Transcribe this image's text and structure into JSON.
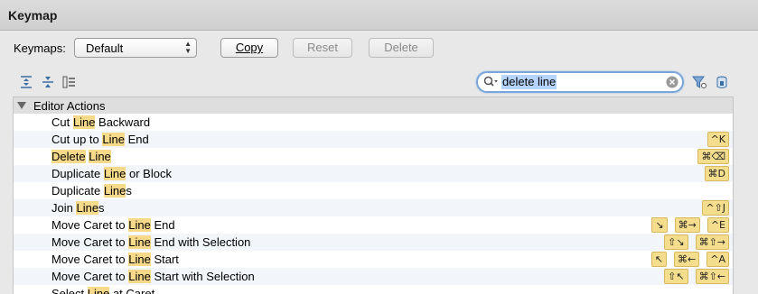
{
  "window": {
    "title": "Keymap"
  },
  "keymaps": {
    "label": "Keymaps:",
    "selected": "Default",
    "copy_label": "Copy",
    "reset_label": "Reset",
    "delete_label": "Delete"
  },
  "toolbar": {
    "icons": [
      "expand-all-icon",
      "collapse-all-icon",
      "edit-shortcut-icon",
      "filter-by-shortcut-icon",
      "clear-filter-icon"
    ]
  },
  "search": {
    "value": "delete line"
  },
  "tree": {
    "group_label": "Editor Actions",
    "actions": [
      {
        "pre": "Cut ",
        "hl": "Line",
        "post": " Backward",
        "keys": []
      },
      {
        "pre": "Cut up to ",
        "hl": "Line",
        "post": " End",
        "keys": [
          "^K"
        ]
      },
      {
        "pre": "",
        "hl": "Delete",
        "mid": " ",
        "hl2": "Line",
        "post": "",
        "keys": [
          "⌘⌫"
        ]
      },
      {
        "pre": "Duplicate ",
        "hl": "Line",
        "post": " or Block",
        "keys": [
          "⌘D"
        ]
      },
      {
        "pre": "Duplicate ",
        "hl": "Line",
        "post": "s",
        "keys": []
      },
      {
        "pre": "Join ",
        "hl": "Line",
        "post": "s",
        "keys": [
          "^⇧J"
        ]
      },
      {
        "pre": "Move Caret to ",
        "hl": "Line",
        "post": " End",
        "keys": [
          "↘",
          "⌘→",
          "^E"
        ]
      },
      {
        "pre": "Move Caret to ",
        "hl": "Line",
        "post": " End with Selection",
        "keys": [
          "⇧↘",
          "⌘⇧→"
        ]
      },
      {
        "pre": "Move Caret to ",
        "hl": "Line",
        "post": " Start",
        "keys": [
          "↖",
          "⌘←",
          "^A"
        ]
      },
      {
        "pre": "Move Caret to ",
        "hl": "Line",
        "post": " Start with Selection",
        "keys": [
          "⇧↖",
          "⌘⇧←"
        ]
      },
      {
        "pre": "Select ",
        "hl": "Line",
        "post": " at Caret",
        "keys": []
      }
    ]
  },
  "colors": {
    "highlight": "#f7d98a",
    "shortcut_bg": "#f4dd8c",
    "search_selection": "#b5d5ff",
    "focus_ring": "#7aa5d8"
  }
}
